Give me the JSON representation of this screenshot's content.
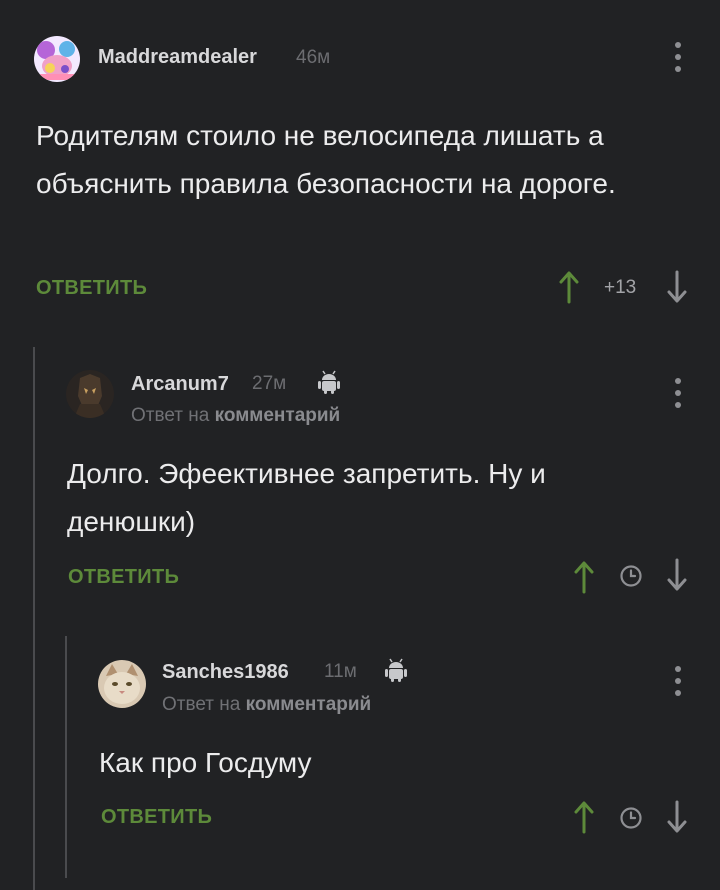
{
  "comments": [
    {
      "username": "Maddreamdealer",
      "time": "46м",
      "text": "Родителям стоило не велосипеда лишать а объяснить правила безопасности на дороге.",
      "reply_label": "ОТВЕТИТЬ",
      "rating": "+13"
    },
    {
      "username": "Arcanum7",
      "time": "27м",
      "reply_prefix": "Ответ на",
      "reply_link": "комментарий",
      "text": "Долго. Эфеективнее запретить. Ну и денюшки)",
      "reply_label": "ОТВЕТИТЬ"
    },
    {
      "username": "Sanches1986",
      "time": "11м",
      "reply_prefix": "Ответ на",
      "reply_link": "комментарий",
      "text": "Как про Госдуму",
      "reply_label": "ОТВЕТИТЬ"
    }
  ],
  "colors": {
    "background": "#212224",
    "accent_green": "#5d8a3a",
    "thread_line": "#4a4b4e"
  },
  "icons": [
    "more-vertical-icon",
    "upvote-arrow-icon",
    "downvote-arrow-icon",
    "clock-icon",
    "android-icon"
  ]
}
